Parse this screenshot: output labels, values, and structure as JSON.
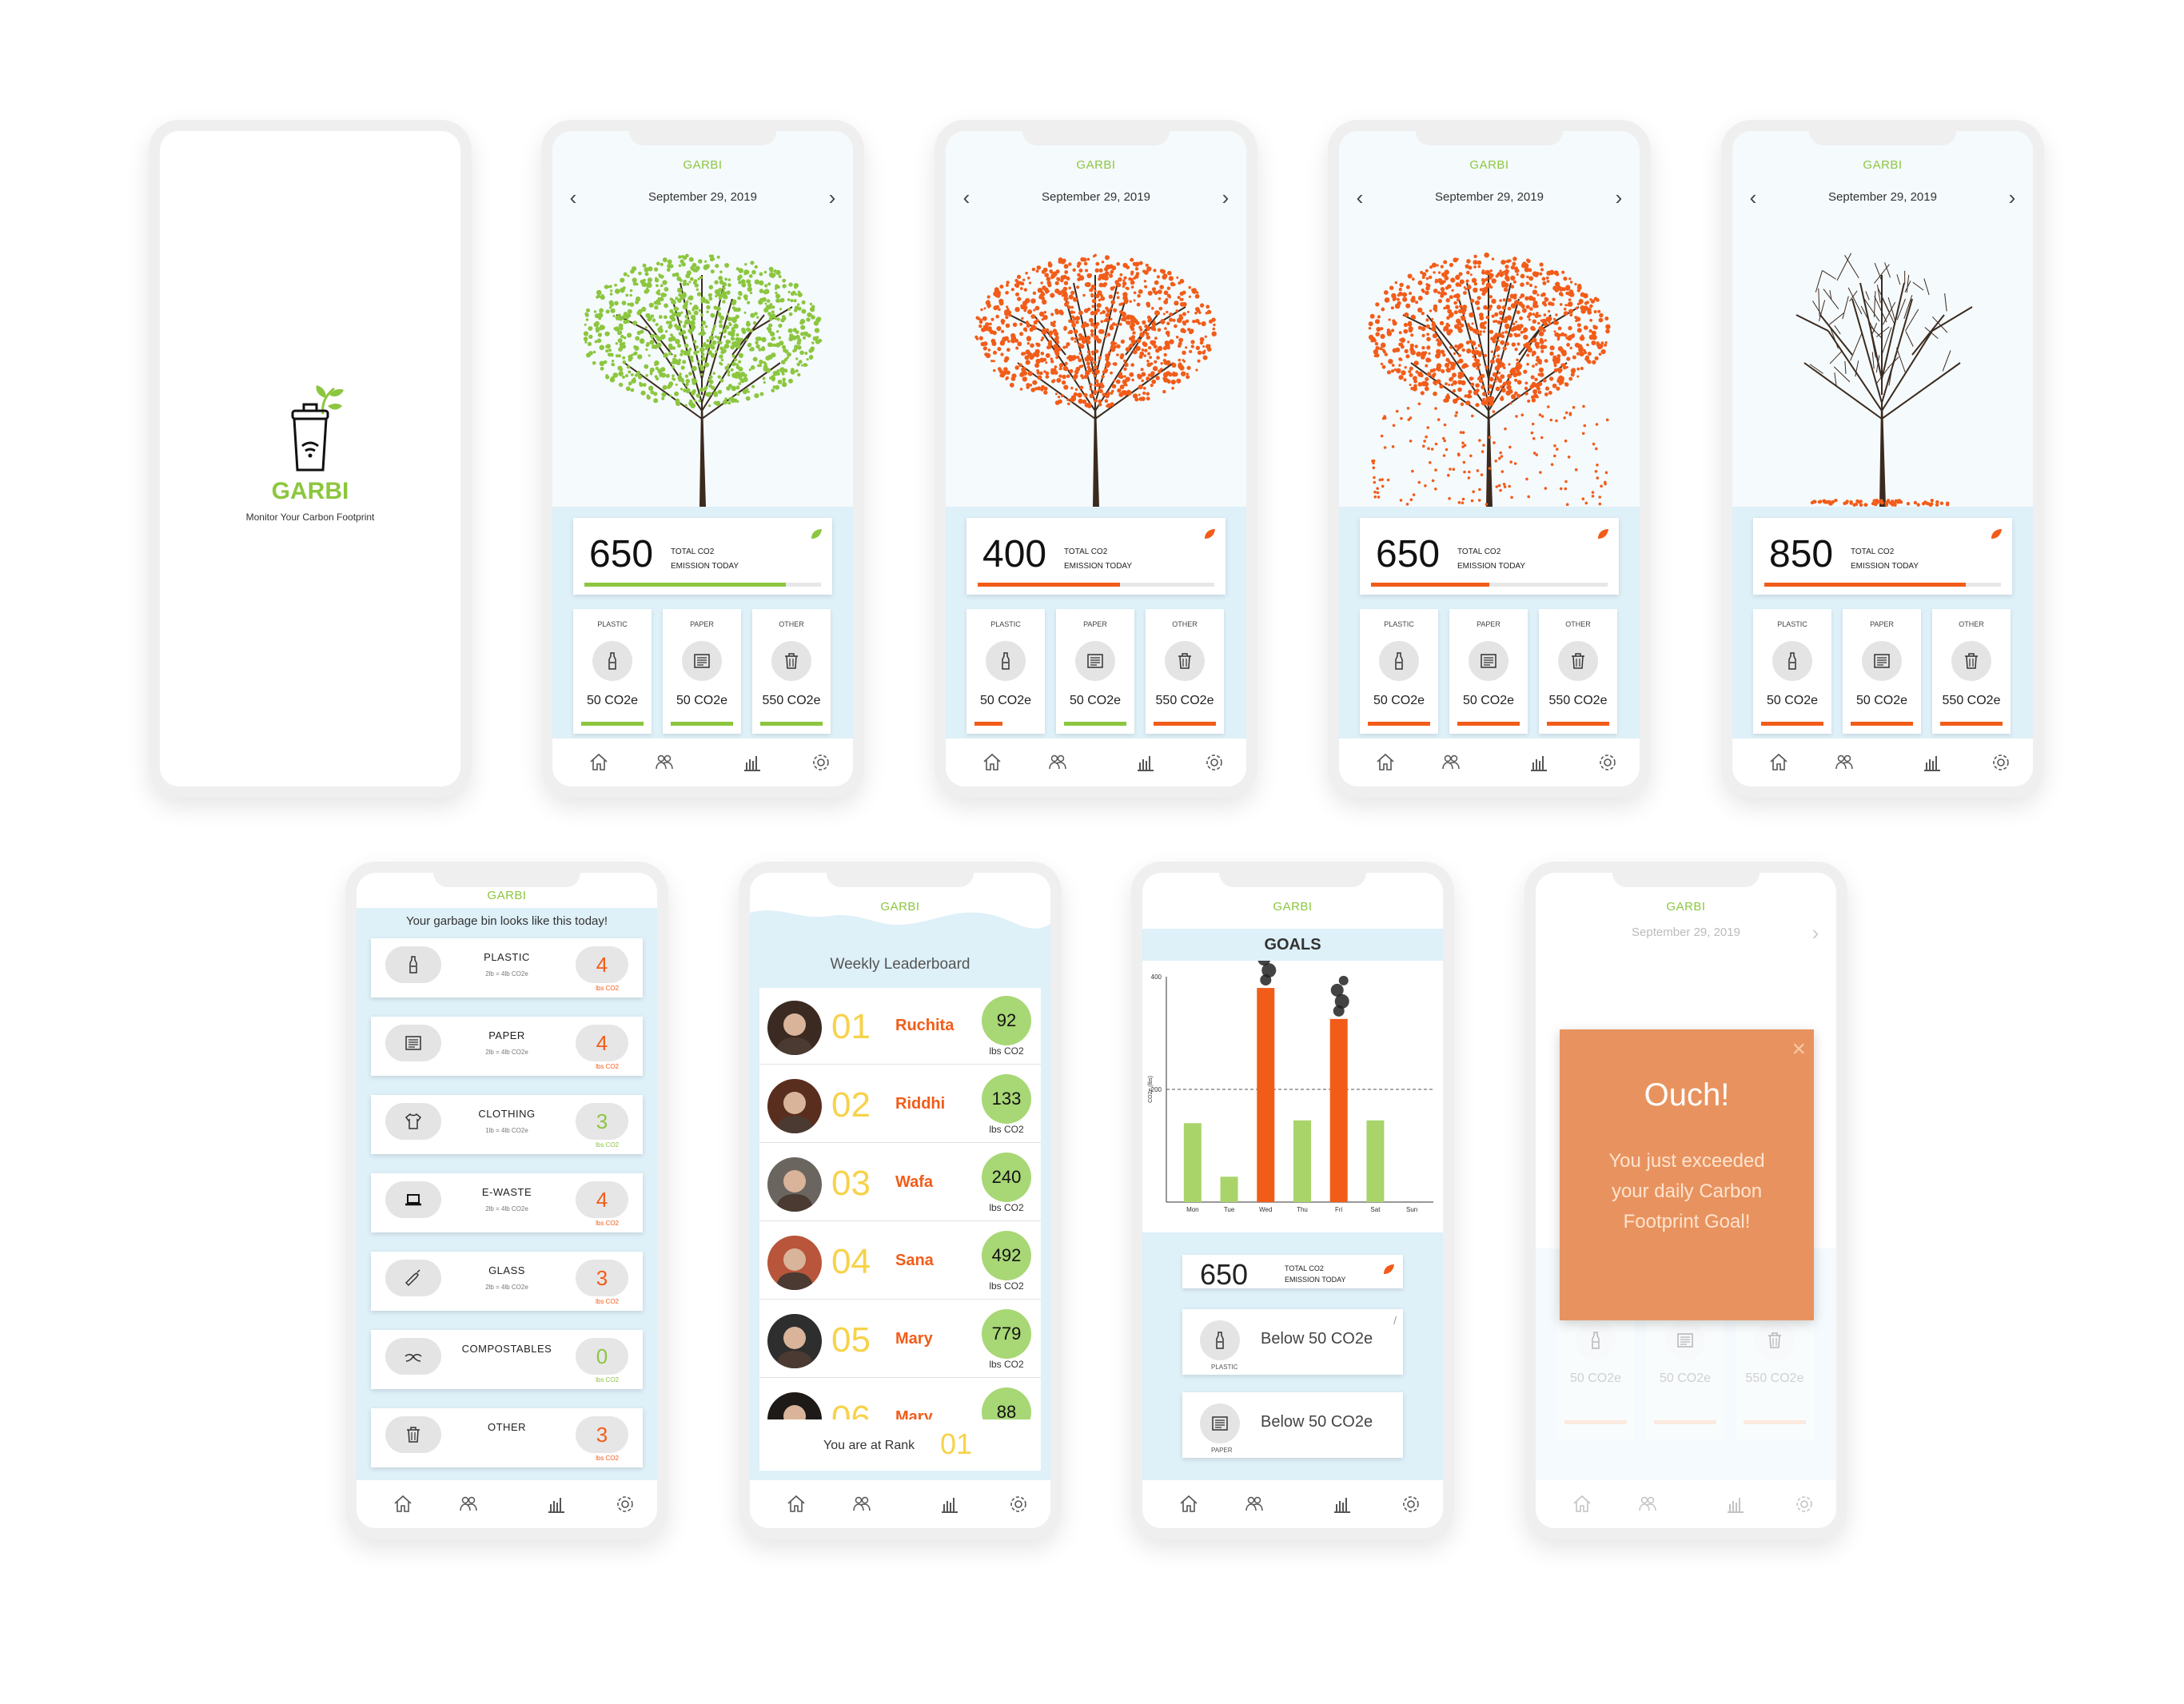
{
  "app": {
    "brand": "GARBI",
    "tagline": "Monitor Your Carbon Footprint",
    "date": "September 29, 2019",
    "prev_arrow": "‹",
    "next_arrow": "›"
  },
  "colors": {
    "green": "#8cc63f",
    "orange": "#f25c19",
    "light_blue": "#def0f8",
    "gold": "#f7d24a",
    "popup": "#e8935f"
  },
  "tabs": [
    "home-icon",
    "community-icon",
    "stats-icon",
    "settings-icon"
  ],
  "dashboards": [
    {
      "tree": "green",
      "total": "650",
      "total_label_1": "TOTAL CO2",
      "total_label_2": "EMISSION TODAY",
      "progress": 0.85,
      "progress_color": "#8cc63f",
      "leaf_color": "#8cc63f",
      "categories": [
        {
          "title": "PLASTIC",
          "value": "50 CO2e",
          "bar": "#8cc63f"
        },
        {
          "title": "PAPER",
          "value": "50 CO2e",
          "bar": "#8cc63f"
        },
        {
          "title": "OTHER",
          "value": "550 CO2e",
          "bar": "#8cc63f"
        }
      ]
    },
    {
      "tree": "orange",
      "total": "400",
      "total_label_1": "TOTAL CO2",
      "total_label_2": "EMISSION TODAY",
      "progress": 0.6,
      "progress_color": "#f25c19",
      "leaf_color": "#f25c19",
      "categories": [
        {
          "title": "PLASTIC",
          "value": "50 CO2e",
          "bar": "#f25c19",
          "bar_fill": 0.45
        },
        {
          "title": "PAPER",
          "value": "50 CO2e",
          "bar": "#8cc63f"
        },
        {
          "title": "OTHER",
          "value": "550 CO2e",
          "bar": "#f25c19"
        }
      ]
    },
    {
      "tree": "falling",
      "total": "650",
      "total_label_1": "TOTAL CO2",
      "total_label_2": "EMISSION TODAY",
      "progress": 0.5,
      "progress_color": "#f25c19",
      "leaf_color": "#f25c19",
      "categories": [
        {
          "title": "PLASTIC",
          "value": "50 CO2e",
          "bar": "#f25c19"
        },
        {
          "title": "PAPER",
          "value": "50 CO2e",
          "bar": "#f25c19"
        },
        {
          "title": "OTHER",
          "value": "550 CO2e",
          "bar": "#f25c19"
        }
      ]
    },
    {
      "tree": "bare",
      "total": "850",
      "total_label_1": "TOTAL CO2",
      "total_label_2": "EMISSION TODAY",
      "progress": 0.85,
      "progress_color": "#f25c19",
      "leaf_color": "#f25c19",
      "categories": [
        {
          "title": "PLASTIC",
          "value": "50 CO2e",
          "bar": "#f25c19"
        },
        {
          "title": "PAPER",
          "value": "50 CO2e",
          "bar": "#f25c19"
        },
        {
          "title": "OTHER",
          "value": "550 CO2e",
          "bar": "#f25c19"
        }
      ]
    }
  ],
  "garbage": {
    "heading": "Your garbage bin looks like this today!",
    "items": [
      {
        "name": "PLASTIC",
        "sub": "2lb = 4lb CO2e",
        "count": "4",
        "unit": "lbs CO2",
        "color": "#f25c19",
        "icon": "bottle-icon"
      },
      {
        "name": "PAPER",
        "sub": "2lb = 4lb CO2e",
        "count": "4",
        "unit": "lbs CO2",
        "color": "#f25c19",
        "icon": "paper-icon"
      },
      {
        "name": "CLOTHING",
        "sub": "1lb = 4lb CO2e",
        "count": "3",
        "unit": "lbs CO2",
        "color": "#8cc63f",
        "icon": "shirt-icon"
      },
      {
        "name": "E-WASTE",
        "sub": "2lb = 4lb CO2e",
        "count": "4",
        "unit": "lbs CO2",
        "color": "#f25c19",
        "icon": "laptop-icon"
      },
      {
        "name": "GLASS",
        "sub": "2lb = 4lb CO2e",
        "count": "3",
        "unit": "lbs CO2",
        "color": "#f25c19",
        "icon": "glass-bottle-icon"
      },
      {
        "name": "COMPOSTABLES",
        "sub": "",
        "count": "0",
        "unit": "lbs CO2",
        "color": "#8cc63f",
        "icon": "banana-peel-icon"
      },
      {
        "name": "OTHER",
        "sub": "",
        "count": "3",
        "unit": "lbs CO2",
        "color": "#f25c19",
        "icon": "trash-icon"
      }
    ]
  },
  "leaderboard": {
    "title": "Weekly Leaderboard",
    "rows": [
      {
        "rank": "01",
        "name": "Ruchita",
        "score": "92",
        "unit": "lbs CO2",
        "avatar": "#3b2a22"
      },
      {
        "rank": "02",
        "name": "Riddhi",
        "score": "133",
        "unit": "lbs CO2",
        "avatar": "#5a2e1e"
      },
      {
        "rank": "03",
        "name": "Wafa",
        "score": "240",
        "unit": "lbs CO2",
        "avatar": "#6b6560"
      },
      {
        "rank": "04",
        "name": "Sana",
        "score": "492",
        "unit": "lbs CO2",
        "avatar": "#b8553a"
      },
      {
        "rank": "05",
        "name": "Mary",
        "score": "779",
        "unit": "lbs CO2",
        "avatar": "#2e2e2e"
      },
      {
        "rank": "06",
        "name": "Mary",
        "score": "88",
        "unit": "lbs CO2",
        "avatar": "#1e1a18"
      }
    ],
    "you_text": "You are at Rank",
    "you_rank": "01"
  },
  "goals": {
    "title": "GOALS",
    "total": "650",
    "total_label_1": "TOTAL CO2",
    "total_label_2": "EMISSION TODAY",
    "cards": [
      {
        "label": "PLASTIC",
        "text": "Below 50 CO2e"
      },
      {
        "label": "PAPER",
        "text": "Below 50 CO2e"
      }
    ],
    "chart_data": {
      "type": "bar",
      "categories": [
        "Mon",
        "Tue",
        "Wed",
        "Thu",
        "Fri",
        "Sat",
        "Sun"
      ],
      "values": [
        140,
        45,
        380,
        145,
        325,
        145,
        0
      ],
      "colors": [
        "#a9d46a",
        "#a9d46a",
        "#f25c19",
        "#a9d46a",
        "#f25c19",
        "#a9d46a",
        "#a9d46a"
      ],
      "ylabel": "CO2e (lbs)",
      "yticks": [
        200,
        400
      ],
      "ylim": [
        0,
        400
      ],
      "goal_line": 200,
      "smoke": [
        "Wed",
        "Fri"
      ]
    }
  },
  "popup": {
    "date": "September 29, 2019",
    "title": "Ouch!",
    "message": "You just exceeded your daily Carbon Footprint Goal!",
    "close": "×",
    "categories": [
      {
        "value": "50 CO2e"
      },
      {
        "value": "50 CO2e"
      },
      {
        "value": "550 CO2e"
      }
    ]
  }
}
